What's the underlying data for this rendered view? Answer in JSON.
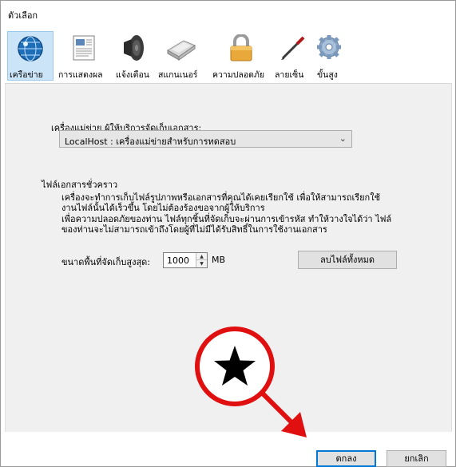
{
  "window": {
    "title": "ตัวเลือก"
  },
  "toolbar": {
    "tabs": [
      {
        "label": "เครือข่าย",
        "icon": "network-globe-icon",
        "selected": true
      },
      {
        "label": "การแสดงผล",
        "icon": "display-document-icon",
        "selected": false
      },
      {
        "label": "แจ้งเตือน",
        "icon": "speaker-icon",
        "selected": false
      },
      {
        "label": "สแกนเนอร์",
        "icon": "scanner-icon",
        "selected": false
      },
      {
        "label": "ความปลอดภัย",
        "icon": "padlock-icon",
        "selected": false
      },
      {
        "label": "ลายเซ็น",
        "icon": "pen-icon",
        "selected": false
      },
      {
        "label": "ขั้นสูง",
        "icon": "gear-icon",
        "selected": false
      }
    ]
  },
  "network": {
    "server_label": "เครื่องแม่ข่าย ผู้ให้บริการจัดเก็บเอกสาร:",
    "server_selected": "LocalHost : เครื่องแม่ข่ายสำหรับการทดสอบ"
  },
  "temp_files": {
    "heading": "ไฟล์เอกสารชั่วคราว",
    "lines": [
      "เครื่องจะทำการเก็บไฟล์รูปภาพหรือเอกสารที่คุณได้เคยเรียกใช้ เพื่อให้สามารถเรียกใช้",
      "งานไฟล์นั้นได้เร็วขึ้น โดยไม่ต้องร้องขอจากผู้ให้บริการ",
      "เพื่อความปลอดภัยของท่าน ไฟล์ทุกชิ้นที่จัดเก็บจะผ่านการเข้ารหัส ทำให้วางใจได้ว่า ไฟล์",
      "ของท่านจะไม่สามารถเข้าถึงโดยผู้ที่ไม่มีได้รับสิทธิ์ในการใช้งานเอกสาร"
    ],
    "max_size_label": "ขนาดพื้นที่จัดเก็บสูงสุด:",
    "max_size_value": "1000",
    "unit": "MB",
    "clear_button": "ลบไฟล์ทั้งหมด"
  },
  "footer": {
    "ok_button": "ตกลง",
    "cancel_button": "ยกเลิก"
  },
  "colors": {
    "accent": "#0078d7",
    "annotation": "#e01010",
    "selected_tab_bg": "#cce4f7"
  }
}
